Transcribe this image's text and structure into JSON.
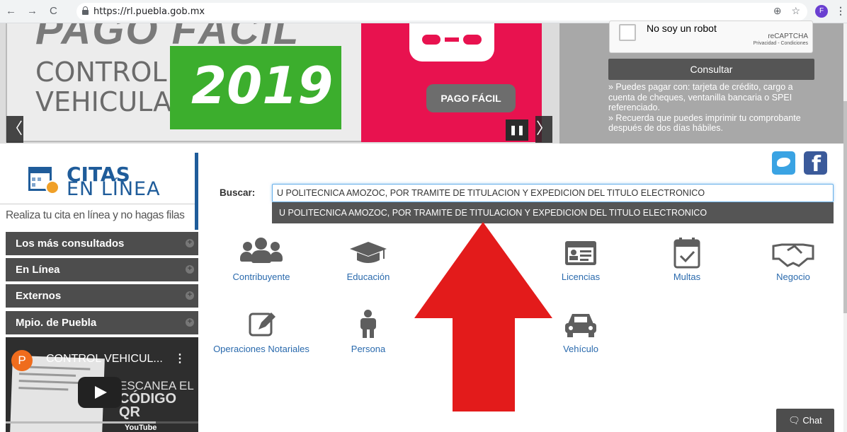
{
  "browser": {
    "url": "https://rl.puebla.gob.mx",
    "profile_initial": "F"
  },
  "banner": {
    "headline_partial": "PAGO FÁCIL",
    "control_line1": "CONTROL",
    "control_line2": "VEHICULAR",
    "year": "2019",
    "pago_button": "PAGO FÁCIL",
    "prev_glyph": "〈",
    "next_glyph": "〉",
    "pause_glyph": "❚❚"
  },
  "consult": {
    "captcha_label": "No soy un robot",
    "recaptcha_brand": "reCAPTCHA",
    "recaptcha_links": "Privacidad - Condiciones",
    "button": "Consultar",
    "info_line1": "» Puedes pagar con: tarjeta de crédito, cargo a cuenta de cheques, ventanilla bancaria o SPEI referenciado.",
    "info_line2": "» Recuerda que puedes imprimir tu comprobante después de dos días hábiles."
  },
  "citas": {
    "title1": "CITAS",
    "title2": "EN LÍNEA",
    "slogan": "Realiza tu cita en línea y no hagas filas"
  },
  "menu": [
    {
      "label": "Los más consultados"
    },
    {
      "label": "En Línea"
    },
    {
      "label": "Externos"
    },
    {
      "label": "Mpio. de Puebla"
    }
  ],
  "video": {
    "channel_initial": "P",
    "title": "CONTROL VEHICUL...",
    "overlay_line1": "ESCANEA EL",
    "overlay_line2": "CÓDIGO QR",
    "footer": "YouTube"
  },
  "search": {
    "label": "Buscar:",
    "value": "U POLITECNICA AMOZOC, POR TRAMITE DE TITULACION Y EXPEDICION DEL TITULO ELECTRONICO",
    "suggestion": "U POLITECNICA AMOZOC, POR TRAMITE DE TITULACION Y EXPEDICION DEL TITULO ELECTRONICO"
  },
  "categories": [
    {
      "label": "Contribuyente",
      "icon": "people-group-icon"
    },
    {
      "label": "Educación",
      "icon": "graduation-cap-icon"
    },
    {
      "label": "Licencias",
      "icon": "id-card-icon"
    },
    {
      "label": "Multas",
      "icon": "calendar-check-icon"
    },
    {
      "label": "Negocio",
      "icon": "handshake-icon"
    },
    {
      "label": "Operaciones Notariales",
      "icon": "edit-icon"
    },
    {
      "label": "Persona",
      "icon": "person-icon"
    },
    {
      "label": "Vehículo",
      "icon": "car-icon"
    }
  ],
  "chat": {
    "label": "Chat"
  },
  "colors": {
    "brand_blue": "#1f5c9a",
    "link_blue": "#2a6aad",
    "menu_gray": "#4d4d4d",
    "banner_green": "#3cae2d",
    "banner_pink": "#e8124f",
    "arrow_red": "#e31b1b"
  }
}
